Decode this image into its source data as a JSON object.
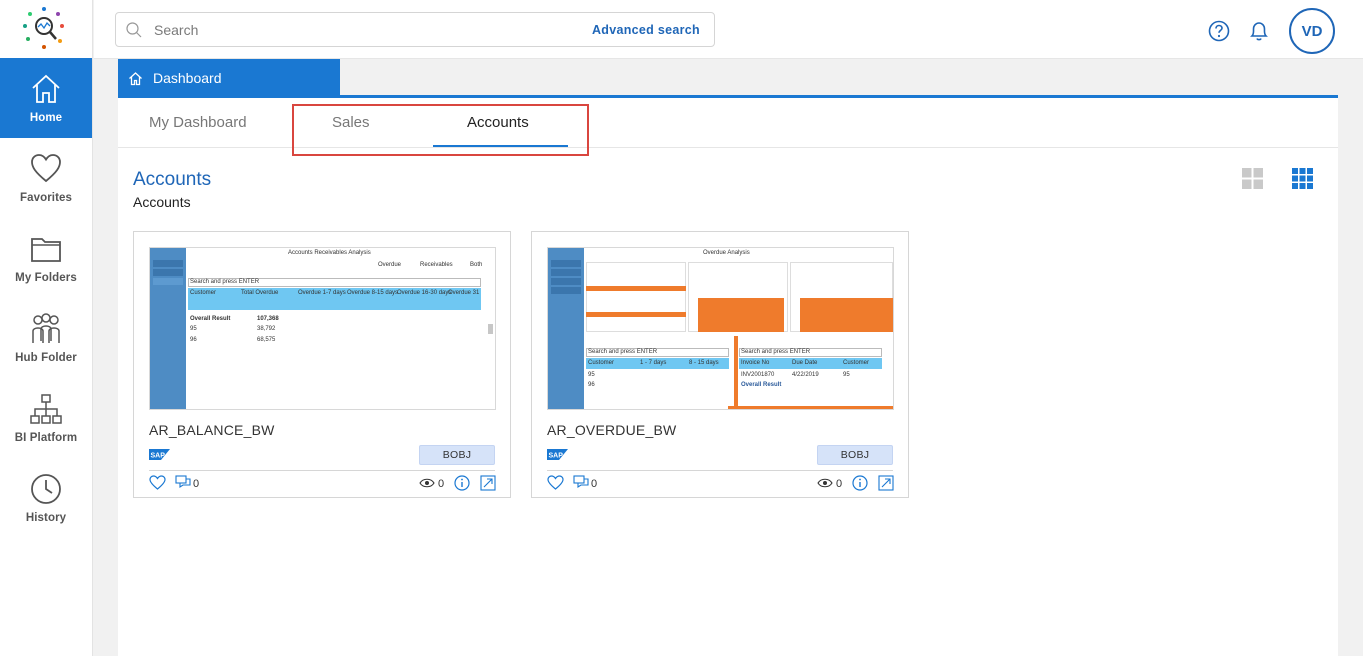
{
  "nav": {
    "items": [
      {
        "label": "Home",
        "icon": "home-icon"
      },
      {
        "label": "Favorites",
        "icon": "heart-icon"
      },
      {
        "label": "My Folders",
        "icon": "folder-icon"
      },
      {
        "label": "Hub Folder",
        "icon": "people-icon"
      },
      {
        "label": "BI Platform",
        "icon": "hierarchy-icon"
      },
      {
        "label": "History",
        "icon": "clock-icon"
      }
    ]
  },
  "topbar": {
    "search_placeholder": "Search",
    "advanced_search": "Advanced search",
    "avatar_initials": "VD"
  },
  "breadcrumb": {
    "label": "Dashboard"
  },
  "tabs": [
    {
      "label": "My Dashboard",
      "active": false
    },
    {
      "label": "Sales",
      "active": false
    },
    {
      "label": "Accounts",
      "active": true
    }
  ],
  "section": {
    "title": "Accounts",
    "subtitle": "Accounts"
  },
  "cards": [
    {
      "name": "AR_BALANCE_BW",
      "badge": "BOBJ",
      "comments": "0",
      "views": "0",
      "thumb": {
        "title": "Accounts Receivables Analysis",
        "radio_overdue": "Overdue",
        "radio_receivables": "Receivables",
        "radio_both": "Both",
        "search": "Search and press ENTER",
        "cols": [
          "Customer",
          "Total Overdue",
          "Overdue 1-7 days",
          "Overdue 8-15 days",
          "Overdue 16-30 days",
          "Overdue 31"
        ],
        "rows": [
          [
            "Overall Result",
            "107,368"
          ],
          [
            "95",
            "38,792"
          ],
          [
            "96",
            "68,575"
          ]
        ]
      }
    },
    {
      "name": "AR_OVERDUE_BW",
      "badge": "BOBJ",
      "comments": "0",
      "views": "0",
      "thumb": {
        "title": "Overdue Analysis",
        "search": "Search and press ENTER",
        "left_cols": [
          "Customer",
          "1 - 7 days",
          "8 - 15 days"
        ],
        "left_rows": [
          "95",
          "96"
        ],
        "right_cols": [
          "Invoice No",
          "Due Date",
          "Customer"
        ],
        "right_row": [
          "INV2001870",
          "4/22/2019",
          "95"
        ],
        "right_total": "Overall Result"
      }
    }
  ],
  "colors": {
    "accent": "#1a78d2",
    "link": "#1f66b7",
    "highlight_box": "#d9463f",
    "badge_bg": "#d6e3f9",
    "chart_orange": "#ef7b2c"
  }
}
